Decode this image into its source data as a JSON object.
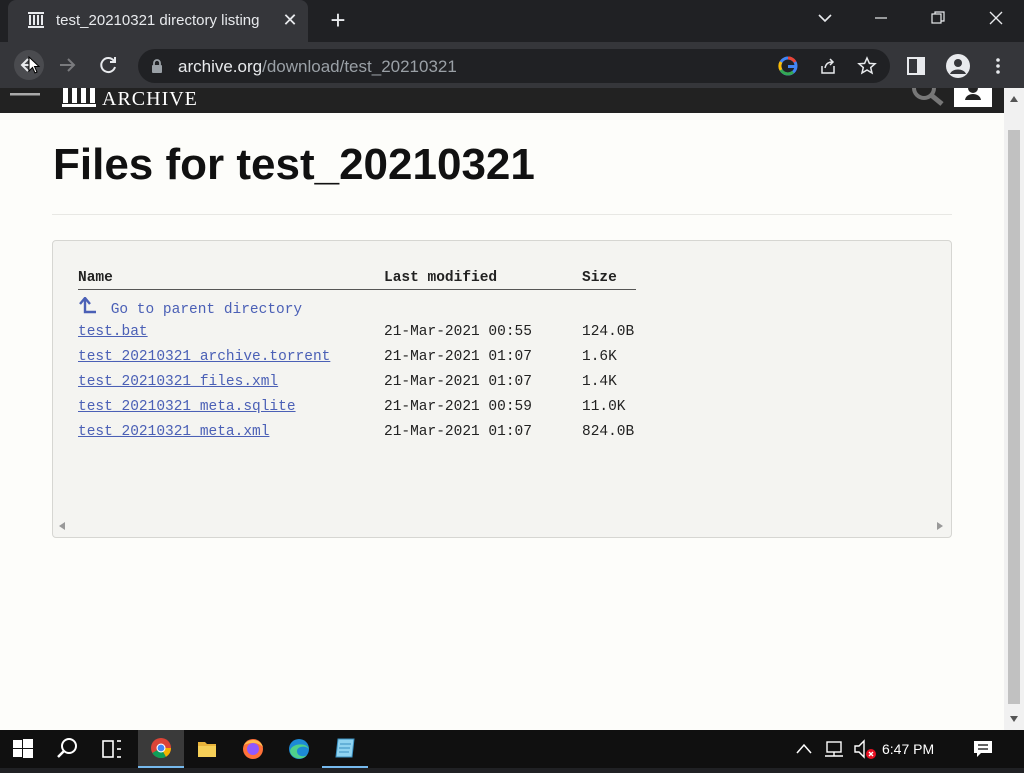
{
  "browser": {
    "tab_title": "test_20210321 directory listing",
    "url_host": "archive.org",
    "url_path": "/download/test_20210321"
  },
  "site": {
    "logo_text": "ARCHIVE"
  },
  "page": {
    "heading": "Files for test_20210321",
    "columns": {
      "name": "Name",
      "modified": "Last modified",
      "size": "Size"
    },
    "parent_link": "Go to parent directory",
    "files": [
      {
        "name": "test.bat",
        "modified": "21-Mar-2021 00:55",
        "size": "124.0B"
      },
      {
        "name": "test_20210321_archive.torrent",
        "modified": "21-Mar-2021 01:07",
        "size": "1.6K"
      },
      {
        "name": "test_20210321_files.xml",
        "modified": "21-Mar-2021 01:07",
        "size": "1.4K"
      },
      {
        "name": "test_20210321_meta.sqlite",
        "modified": "21-Mar-2021 00:59",
        "size": "11.0K"
      },
      {
        "name": "test_20210321_meta.xml",
        "modified": "21-Mar-2021 01:07",
        "size": "824.0B"
      }
    ]
  },
  "taskbar": {
    "apps": [
      "windows-start-icon",
      "search-icon",
      "task-view-icon",
      "chrome-icon",
      "file-explorer-icon",
      "firefox-icon",
      "edge-icon",
      "notepad-icon"
    ],
    "clock": "6:47 PM"
  },
  "colors": {
    "link": "#4b60b6",
    "chrome_dark": "#202124",
    "chrome_toolbar": "#35363a",
    "page_bg": "#fdfdfa"
  }
}
